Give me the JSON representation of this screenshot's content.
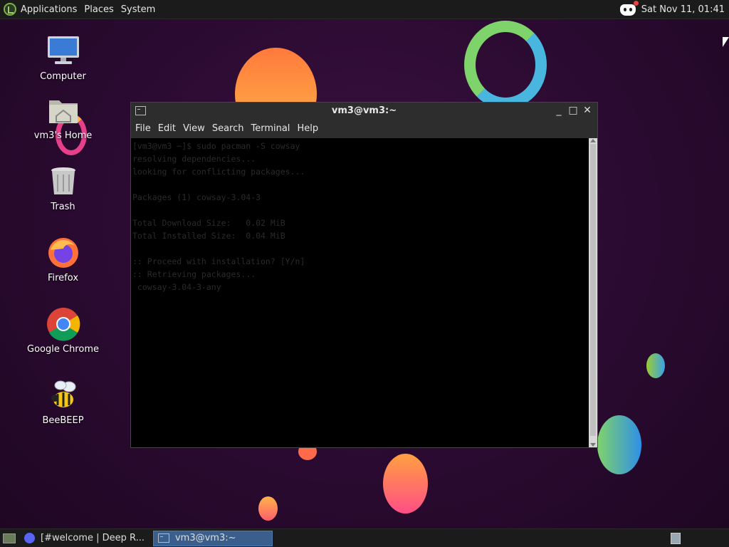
{
  "top_panel": {
    "menu": [
      "Applications",
      "Places",
      "System"
    ],
    "clock": "Sat Nov 11, 01:41"
  },
  "desktop_icons": [
    {
      "label": "Computer",
      "icon": "computer-icon"
    },
    {
      "label": "vm3's Home",
      "icon": "home-folder-icon"
    },
    {
      "label": "Trash",
      "icon": "trash-icon"
    },
    {
      "label": "Firefox",
      "icon": "firefox-icon"
    },
    {
      "label": "Google Chrome",
      "icon": "chrome-icon"
    },
    {
      "label": "BeeBEEP",
      "icon": "bee-icon"
    }
  ],
  "terminal": {
    "title": "vm3@vm3:~",
    "menu": [
      "File",
      "Edit",
      "View",
      "Search",
      "Terminal",
      "Help"
    ],
    "lines": [
      "[vm3@vm3 ~]$ sudo pacman -S cowsay",
      "resolving dependencies...",
      "looking for conflicting packages...",
      "",
      "Packages (1) cowsay-3.04-3",
      "",
      "Total Download Size:   0.02 MiB",
      "Total Installed Size:  0.04 MiB",
      "",
      ":: Proceed with installation? [Y/n]",
      ":: Retrieving packages...",
      " cowsay-3.04-3-any"
    ]
  },
  "taskbar": {
    "tasks": [
      {
        "label": "[#welcome | Deep R...",
        "icon": "discord-icon",
        "active": false
      },
      {
        "label": "vm3@vm3:~",
        "icon": "terminal-icon",
        "active": true
      }
    ]
  },
  "colors": {
    "panel": "#1b1b1b",
    "active_task": "#3a5f8c",
    "wallpaper": "#2a0a30"
  }
}
